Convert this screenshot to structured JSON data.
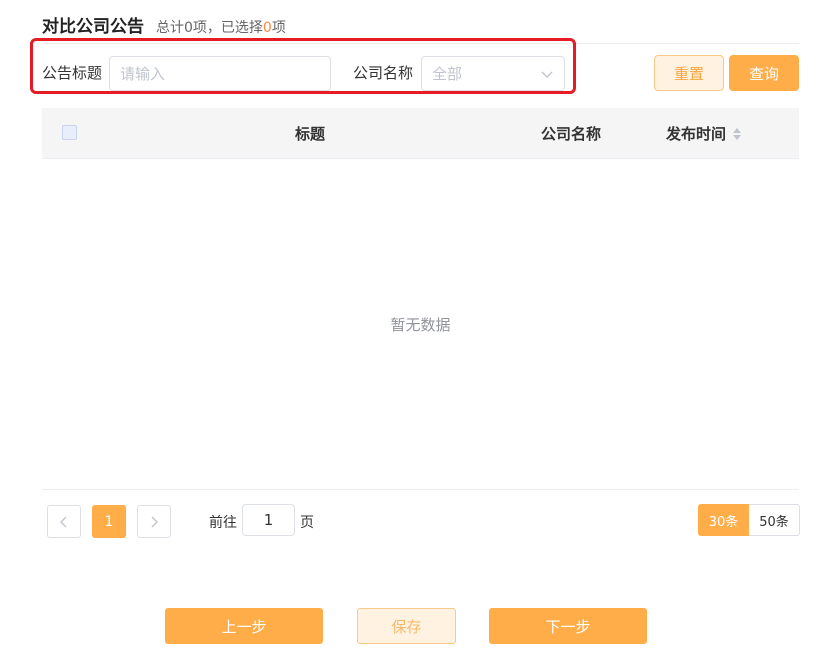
{
  "header": {
    "title": "对比公司公告",
    "summary_prefix": "总计0项，已选择",
    "selected_count": "0",
    "summary_suffix": "项"
  },
  "filters": {
    "title_label": "公告标题",
    "title_placeholder": "请输入",
    "company_label": "公司名称",
    "company_value": "全部",
    "reset_label": "重置",
    "query_label": "查询"
  },
  "table": {
    "columns": [
      "标题",
      "公司名称",
      "发布时间"
    ],
    "rows": [],
    "empty_text": "暂无数据"
  },
  "pagination": {
    "current_page": "1",
    "goto_prefix": "前往",
    "goto_value": "1",
    "goto_suffix": "页",
    "page_sizes": [
      "30条",
      "50条"
    ],
    "selected_size": "30条"
  },
  "footer": {
    "prev_label": "上一步",
    "save_label": "保存",
    "next_label": "下一步"
  },
  "colors": {
    "accent": "#ffad49",
    "accent_light": "#fff2e0",
    "highlight_box": "#e51c23"
  }
}
